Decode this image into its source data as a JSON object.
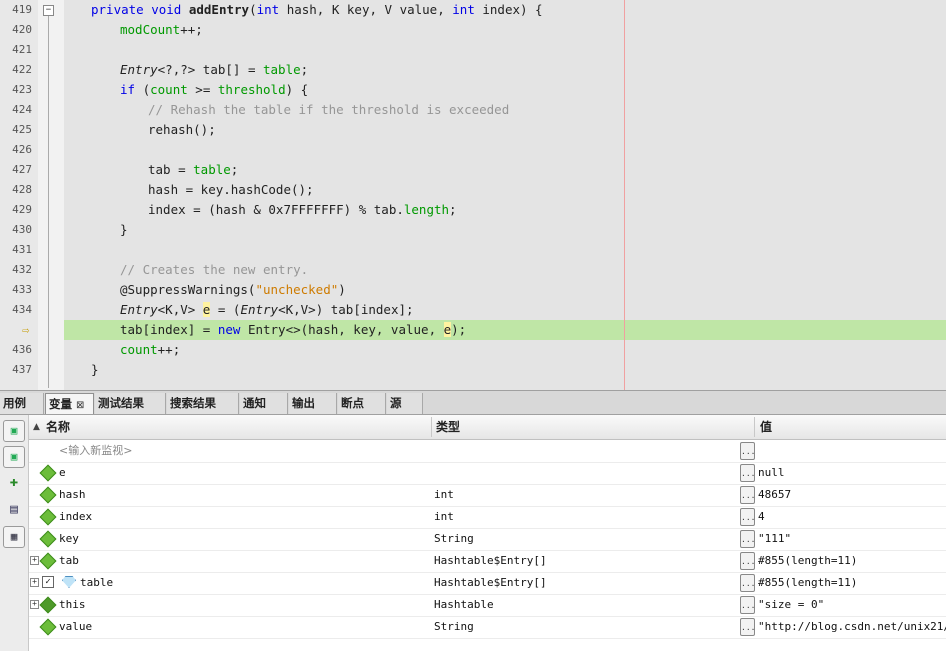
{
  "editor": {
    "lines": [
      {
        "num": "419"
      },
      {
        "num": "420"
      },
      {
        "num": "421"
      },
      {
        "num": "422"
      },
      {
        "num": "423"
      },
      {
        "num": "424"
      },
      {
        "num": "425"
      },
      {
        "num": "426"
      },
      {
        "num": "427"
      },
      {
        "num": "428"
      },
      {
        "num": "429"
      },
      {
        "num": "430"
      },
      {
        "num": "431"
      },
      {
        "num": "432"
      },
      {
        "num": "433"
      },
      {
        "num": "434"
      },
      {
        "num": "435"
      },
      {
        "num": "436"
      },
      {
        "num": "437"
      }
    ],
    "current_line": "435",
    "code": {
      "l419_kw1": "private void ",
      "l419_name": "addEntry",
      "l419_p1": "(",
      "l419_kw2": "int",
      "l419_p2": " hash, K key, V value, ",
      "l419_kw3": "int",
      "l419_p3": " index) {",
      "l420_fld": "modCount",
      "l420_rest": "++;",
      "l422_type": "Entry",
      "l422_a": "<?,?> tab[] = ",
      "l422_fld": "table",
      "l422_b": ";",
      "l423_kw": "if",
      "l423_a": " (",
      "l423_fld1": "count",
      "l423_b": " >= ",
      "l423_fld2": "threshold",
      "l423_c": ") {",
      "l424_cm": "// Rehash the table if the threshold is exceeded",
      "l425": "rehash();",
      "l427_a": "tab = ",
      "l427_fld": "table",
      "l427_b": ";",
      "l428": "hash = key.hashCode();",
      "l429_a": "index = (hash & 0x7FFFFFFF) % tab.",
      "l429_fld": "length",
      "l429_b": ";",
      "l430": "}",
      "l432_cm": "// Creates the new entry.",
      "l433_a": "@SuppressWarnings(",
      "l433_str": "\"unchecked\"",
      "l433_b": ")",
      "l434_t1": "Entry",
      "l434_a": "<K,V> ",
      "l434_e": "e",
      "l434_b": " = (",
      "l434_t2": "Entry",
      "l434_c": "<K,V>) tab[index];",
      "l435_a": "tab[index] = ",
      "l435_kw": "new",
      "l435_b": " Entry<>(hash, key, value, ",
      "l435_e": "e",
      "l435_c": ");",
      "l436_fld": "count",
      "l436_rest": "++;",
      "l437": "}"
    }
  },
  "tabs": [
    {
      "label": "用例"
    },
    {
      "label": "变量",
      "close": "⊠"
    },
    {
      "label": "测试结果"
    },
    {
      "label": "搜索结果"
    },
    {
      "label": "通知"
    },
    {
      "label": "输出"
    },
    {
      "label": "断点"
    },
    {
      "label": "源"
    }
  ],
  "variables": {
    "columns": {
      "name": "名称",
      "type": "类型",
      "value": "值"
    },
    "watch_placeholder": "<输入新监视>",
    "rows": [
      {
        "name": "e",
        "type": "",
        "value": "null"
      },
      {
        "name": "hash",
        "type": "int",
        "value": "48657"
      },
      {
        "name": "index",
        "type": "int",
        "value": "4"
      },
      {
        "name": "key",
        "type": "String",
        "value": "\"111\""
      },
      {
        "name": "tab",
        "type": "Hashtable$Entry[]",
        "value": "#855(length=11)"
      },
      {
        "name": "table",
        "type": "Hashtable$Entry[]",
        "value": "#855(length=11)"
      },
      {
        "name": "this",
        "type": "Hashtable",
        "value": "\"size = 0\""
      },
      {
        "name": "value",
        "type": "String",
        "value": "\"http://blog.csdn.net/unix21/\""
      }
    ],
    "ellipsis": "..."
  },
  "colors": {
    "keyword": "#0000e6",
    "field": "#009900",
    "comment": "#969696",
    "string": "#ce7b00",
    "current_line": "#bfe6a6"
  }
}
